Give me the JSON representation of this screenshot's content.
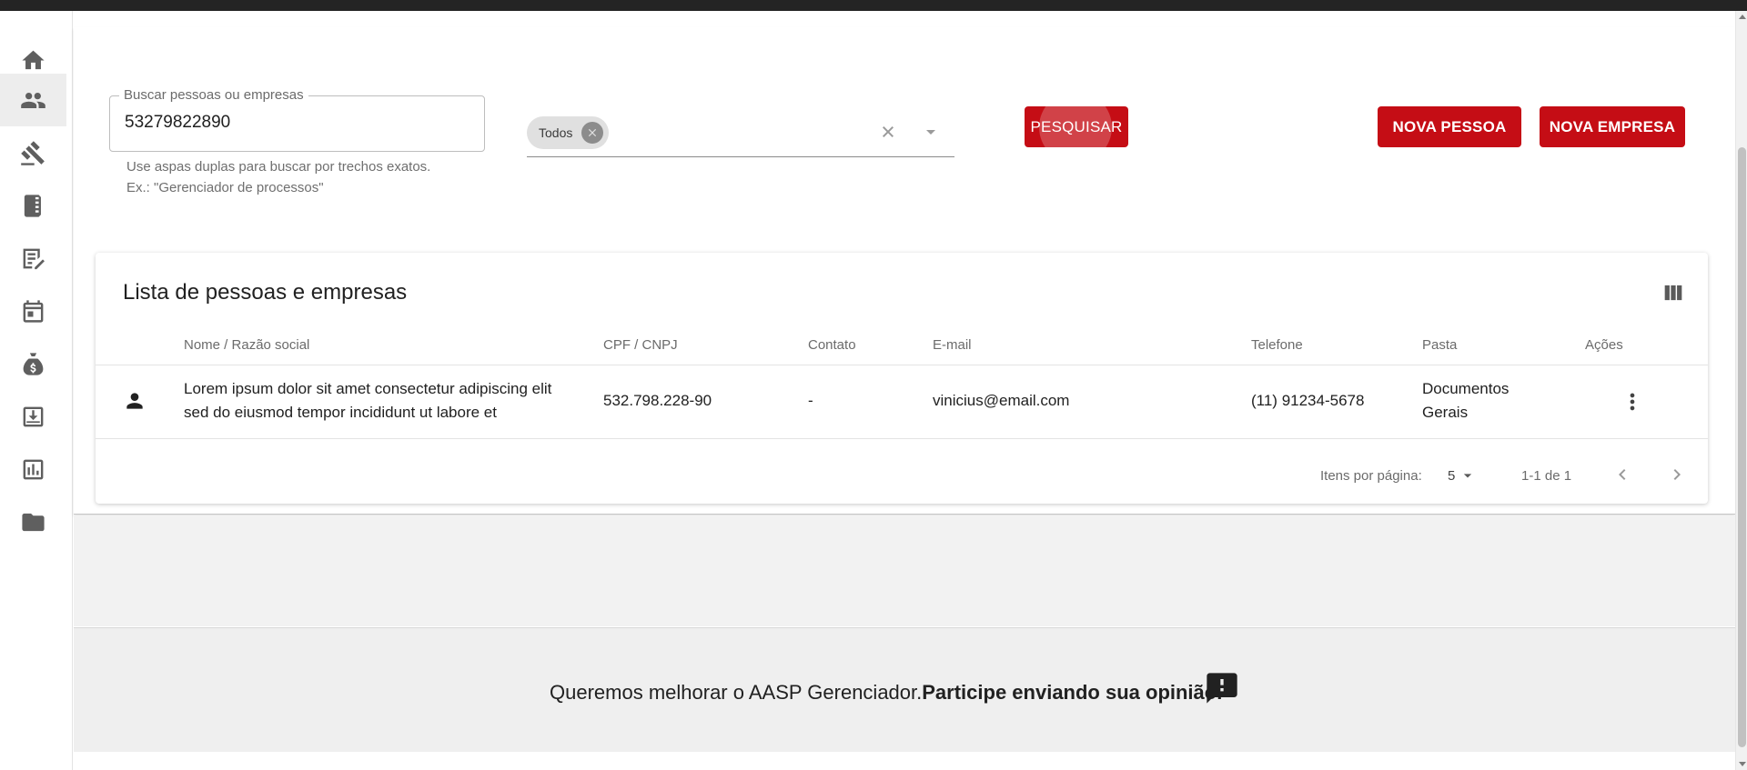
{
  "sidebar": {
    "items": [
      {
        "icon": "home-icon"
      },
      {
        "icon": "people-icon",
        "active": true
      },
      {
        "icon": "gavel-icon"
      },
      {
        "icon": "book-icon"
      },
      {
        "icon": "edit-document-icon"
      },
      {
        "icon": "calendar-icon"
      },
      {
        "icon": "money-bag-icon"
      },
      {
        "icon": "archive-download-icon"
      },
      {
        "icon": "report-chart-icon"
      },
      {
        "icon": "folder-icon"
      }
    ]
  },
  "search": {
    "label": "Buscar pessoas ou empresas",
    "value": "53279822890",
    "hint_line1": "Use aspas duplas para buscar por trechos exatos.",
    "hint_line2": "Ex.: \"Gerenciador de processos\""
  },
  "filter": {
    "chip": "Todos"
  },
  "buttons": {
    "search": "PESQUISAR",
    "new_person": "NOVA PESSOA",
    "new_company": "NOVA EMPRESA"
  },
  "table": {
    "title": "Lista de pessoas e empresas",
    "headers": {
      "name": "Nome / Razão social",
      "doc": "CPF / CNPJ",
      "contact": "Contato",
      "email": "E-mail",
      "phone": "Telefone",
      "folder": "Pasta",
      "actions": "Ações"
    },
    "rows": [
      {
        "name": "Lorem ipsum dolor sit amet consectetur adipiscing elit sed do eiusmod tempor incididunt ut labore et",
        "doc": "532.798.228-90",
        "contact": "-",
        "email": "vinicius@email.com",
        "phone": "(11) 91234-5678",
        "folder": "Documentos Gerais"
      }
    ]
  },
  "pagination": {
    "label": "Itens por página:",
    "per_page": "5",
    "range": "1-1 de 1"
  },
  "feedback": {
    "text": "Queremos melhorar o AASP Gerenciador.",
    "bold": "Participe enviando sua opinião."
  },
  "colors": {
    "primary": "#c50d15",
    "topbar": "#242424"
  }
}
